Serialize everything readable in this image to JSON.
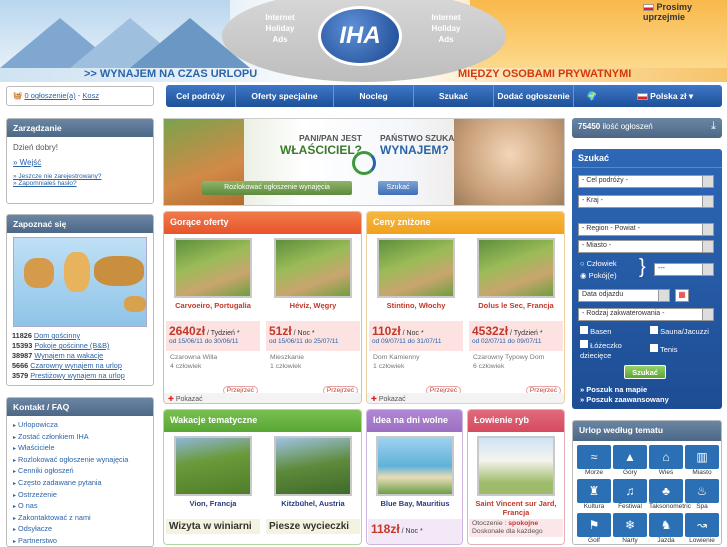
{
  "header": {
    "ihat_left": [
      "Internet",
      "Holiday",
      "Ads"
    ],
    "ihat_right": [
      "Internet",
      "Holiday",
      "Ads"
    ],
    "logo": "IHA",
    "slogan_left": ">> WYNAJEM NA CZAS URLOPU",
    "slogan_right": "MIĘDZY OSOBAMI PRYWATNYMI",
    "apology": "Prosimy uprzejmie"
  },
  "cart": {
    "count_text": "0 ogłoszenie(a)",
    "sep": " - ",
    "cart_label": "Kosz"
  },
  "nav": {
    "items": [
      "Cel podróży",
      "Oferty specjalne",
      "Nocleg",
      "Szukać",
      "Dodać ogłoszenie"
    ],
    "language": "Polska zł"
  },
  "manage": {
    "title": "Zarządzanie",
    "greeting": "Dzień dobry!",
    "login": "Wejść",
    "not_registered": "Jeszcze nie zarejestrowany?",
    "forgot": "Zapomniałeś hasło?"
  },
  "discover": {
    "title": "Zapoznać się",
    "stats": [
      {
        "n": "11826",
        "label": "Dom gościnny"
      },
      {
        "n": "15393",
        "label": "Pokoje gościnne (B&B)"
      },
      {
        "n": "38987",
        "label": "Wynajem na wakacje"
      },
      {
        "n": "5666",
        "label": "Czarowny wynajem na urlop"
      },
      {
        "n": "3579",
        "label": "Prestiżowy wynajem na urlop"
      }
    ]
  },
  "contact": {
    "title": "Kontakt / FAQ",
    "links": [
      "Urlopowicza",
      "Zostać członkiem IHA",
      "Właściciele",
      "Rozlokować ogłoszenie wynajęcia",
      "Cenniki ogłoszeń",
      "Często zadawane pytania",
      "Ostrzeżenie",
      "O nas",
      "Zakontaktować z nami",
      "Odsyłacze",
      "Partnerstwo"
    ]
  },
  "banner": {
    "owner_q1": "PANI/PAN JEST",
    "owner_q2": "WŁAŚCICIEL?",
    "owner_btn": "Rozlokować ogłoszenie wynajęcia",
    "seek_q1": "PAŃSTWO SZUKA",
    "seek_q2": "WYNAJEM?",
    "seek_btn": "Szukać"
  },
  "hot": {
    "title": "Gorące oferty",
    "more": "Pokazać",
    "cards": [
      {
        "title": "Carvoeiro, Portugalia",
        "price": "2640zł",
        "unit": "/ Tydzień *",
        "dates": "od 15/06/11 do 30/06/11",
        "type": "Czarowna Willa",
        "people": "4 człowiek",
        "badge": "Przejrzeć"
      },
      {
        "title": "Hévíz, Węgry",
        "price": "51zł",
        "unit": "/ Noc *",
        "dates": "od 15/06/11 do 25/07/11",
        "type": "Mieszkanie",
        "people": "1 człowiek",
        "badge": "Przejrzeć"
      }
    ]
  },
  "reduced": {
    "title": "Ceny zniżone",
    "more": "Pokazać",
    "cards": [
      {
        "title": "Stintino, Włochy",
        "price": "110zł",
        "unit": "/ Noc *",
        "dates": "od 09/07/11 do 31/07/11",
        "type": "Dom Kamienny",
        "people": "1 człowiek",
        "badge": "Przejrzeć"
      },
      {
        "title": "Dolus le Sec, Francja",
        "price": "4532zł",
        "unit": "/ Tydzień *",
        "dates": "od 02/07/11 do 09/07/11",
        "type": "Czarowny Typowy Dom",
        "people": "6 człowiek",
        "badge": "Przejrzeć"
      }
    ]
  },
  "themed": {
    "title": "Wakacje tematyczne",
    "cards": [
      {
        "title": "Vion, Francja",
        "caption": "Wizyta w winiarni"
      },
      {
        "title": "Kitzbühel, Austria",
        "caption": "Piesze wycieczki"
      }
    ]
  },
  "idea": {
    "title": "Idea na dni wolne",
    "card": {
      "title": "Blue Bay, Mauritius",
      "price": "118zł",
      "unit": "/ Noc *"
    }
  },
  "fishing": {
    "title": "Łowienie ryb",
    "card": {
      "title": "Saint Vincent sur Jard, Francja",
      "sub1": "Otoczenie :",
      "sub1b": "spokojne",
      "sub2": "Doskonałe dla każdego"
    }
  },
  "count": {
    "n": "75450",
    "label": "ilość ogłoszeń"
  },
  "search": {
    "title": "Szukać",
    "dest": "- Cel podróży -",
    "country": "- Kraj -",
    "region": "- Region - Powiat -",
    "city": "- Miasto -",
    "person": "Człowiek",
    "rooms": "Pokój(e)",
    "count_sel": "---",
    "date_ph": "Data odjazdu",
    "type": "- Rodzaj zakwaterowania -",
    "opts": [
      "Basen",
      "Sauna/Jacuzzi",
      "Łóżeczko dziecięce",
      "Tenis"
    ],
    "btn": "Szukać",
    "map": "Poszuk na mapie",
    "adv": "Poszuk zaawansowany"
  },
  "themes": {
    "title": "Urlop według tematu",
    "items": [
      {
        "label": "Morze",
        "icon": "sea-icon",
        "g": "≈"
      },
      {
        "label": "Góry",
        "icon": "mountain-icon",
        "g": "▲"
      },
      {
        "label": "Wieś",
        "icon": "village-icon",
        "g": "⌂"
      },
      {
        "label": "Miasto",
        "icon": "city-icon",
        "g": "▥"
      },
      {
        "label": "Kultura",
        "icon": "culture-icon",
        "g": "♜"
      },
      {
        "label": "Festiwal",
        "icon": "festival-icon",
        "g": "♫"
      },
      {
        "label": "Taksonometric",
        "icon": "nature-icon",
        "g": "♣"
      },
      {
        "label": "Spa",
        "icon": "spa-icon",
        "g": "♨"
      },
      {
        "label": "Golf",
        "icon": "golf-icon",
        "g": "⚑"
      },
      {
        "label": "Narty",
        "icon": "ski-icon",
        "g": "❄"
      },
      {
        "label": "Jazda",
        "icon": "riding-icon",
        "g": "♞"
      },
      {
        "label": "Lowienie",
        "icon": "fishing-icon",
        "g": "↝"
      }
    ]
  },
  "colors": {
    "hot": "#e8542a",
    "reduced": "#f0a21e",
    "themed": "#58a634",
    "idea": "#9c6fc2",
    "fishing": "#d64a5f"
  }
}
